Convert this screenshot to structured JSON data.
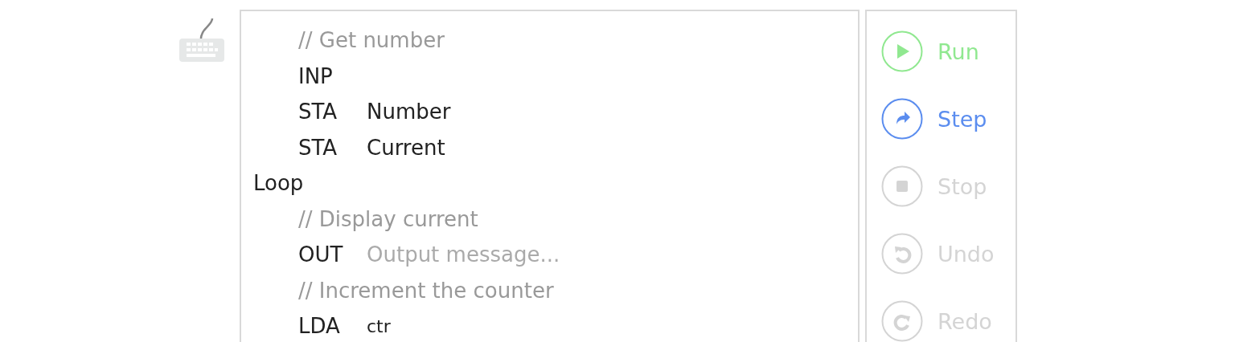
{
  "lines": [
    {
      "kind": "comment",
      "text": "// Get number"
    },
    {
      "kind": "instruction",
      "opcode": "INP"
    },
    {
      "kind": "instruction",
      "opcode": "STA",
      "operand": {
        "kind": "name",
        "text": "Number"
      }
    },
    {
      "kind": "instruction",
      "opcode": "STA",
      "operand": {
        "kind": "name",
        "text": "Current"
      }
    },
    {
      "kind": "label",
      "text": "Loop"
    },
    {
      "kind": "comment",
      "text": "// Display current"
    },
    {
      "kind": "instruction",
      "opcode": "OUT",
      "operand": {
        "kind": "placeholder",
        "text": "Output message..."
      }
    },
    {
      "kind": "comment",
      "text": "// Increment the counter"
    },
    {
      "kind": "instruction",
      "opcode": "LDA",
      "operand": {
        "kind": "variable",
        "text": "ctr"
      }
    }
  ],
  "controls": [
    {
      "kind": "run",
      "label": "Run",
      "disabled": false,
      "color": "#90e890"
    },
    {
      "kind": "step",
      "label": "Step",
      "disabled": false,
      "color": "#5b8def"
    },
    {
      "kind": "stop",
      "label": "Stop",
      "disabled": true
    },
    {
      "kind": "undo",
      "label": "Undo",
      "disabled": true
    },
    {
      "kind": "redo",
      "label": "Redo",
      "disabled": true
    }
  ]
}
